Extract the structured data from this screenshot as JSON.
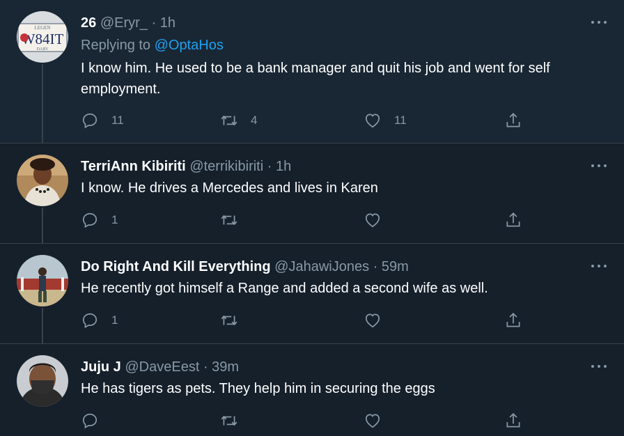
{
  "colors": {
    "background": "#15202b",
    "highlight_background": "#192734",
    "text": "#ffffff",
    "muted": "#8899a6",
    "link": "#1da1f2",
    "divider": "#38444d"
  },
  "tweets": [
    {
      "name": "26",
      "handle": "@Eryr_",
      "separator": "·",
      "time": "1h",
      "replying_prefix": "Replying to",
      "replying_to": "@OptaHos",
      "text": "I know him. He used to be a bank manager and quit his job and went for self employment.",
      "reply_count": "11",
      "retweet_count": "4",
      "like_count": "11",
      "avatar_plate": "W84IT",
      "avatar_plate_top": "LEGEN",
      "avatar_plate_bottom": "DARY"
    },
    {
      "name": "TerriAnn Kibiriti",
      "handle": "@terrikibiriti",
      "separator": "·",
      "time": "1h",
      "text": "I know. He drives a Mercedes and lives in Karen",
      "reply_count": "1",
      "retweet_count": "",
      "like_count": ""
    },
    {
      "name": "Do Right And Kill Everything",
      "handle": "@JahawiJones",
      "separator": "·",
      "time": "59m",
      "text": "He recently got himself a Range and added a second wife as well.",
      "reply_count": "1",
      "retweet_count": "",
      "like_count": ""
    },
    {
      "name": "Juju J",
      "handle": "@DaveEest",
      "separator": "·",
      "time": "39m",
      "text": "He has tigers as pets. They help him in securing the eggs",
      "reply_count": "",
      "retweet_count": "",
      "like_count": ""
    }
  ],
  "icons": {
    "reply": "reply-icon",
    "retweet": "retweet-icon",
    "like": "heart-icon",
    "share": "share-icon",
    "more": "more-icon"
  }
}
